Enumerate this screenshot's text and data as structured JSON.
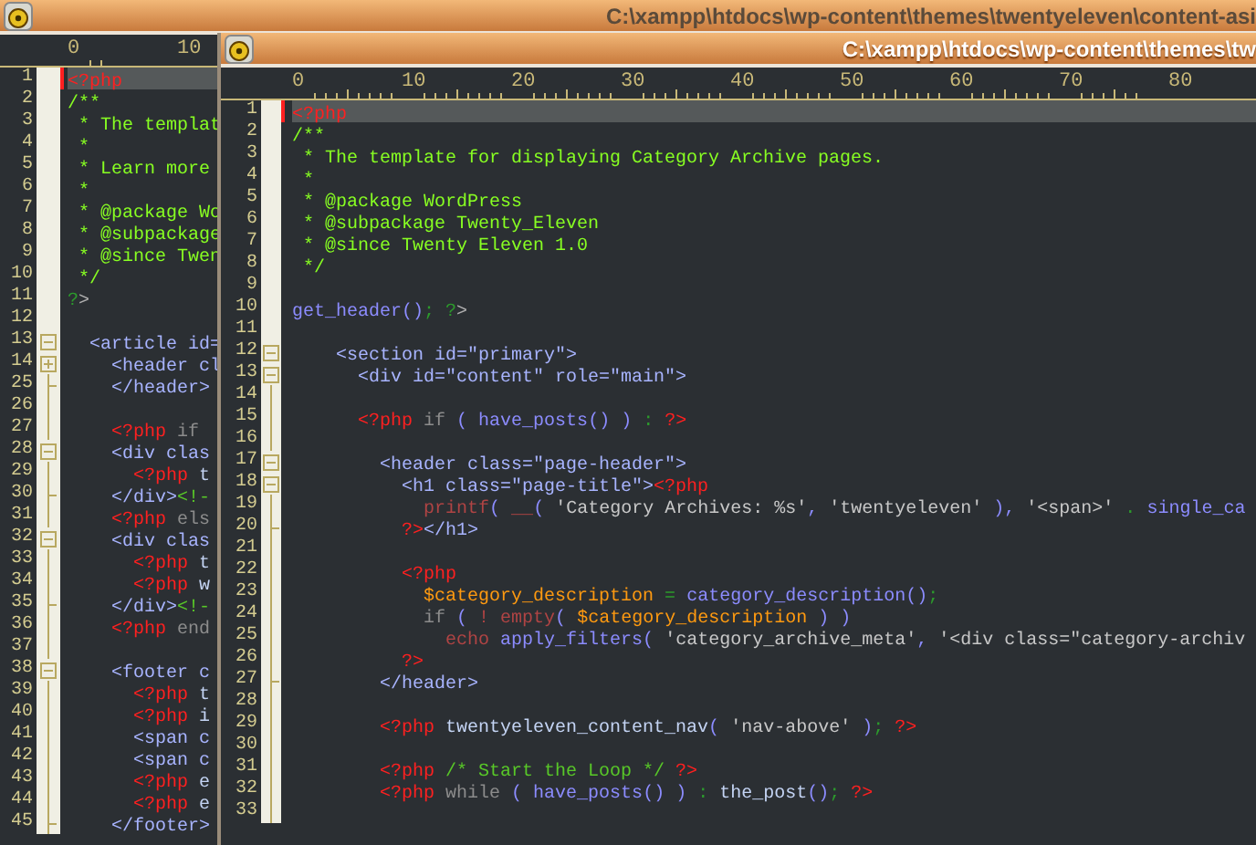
{
  "windows": [
    {
      "title": "C:\\xampp\\htdocs\\wp-content\\themes\\twentyeleven\\content-asi",
      "active": false,
      "ruler": [
        "0",
        "10"
      ],
      "lines": [
        {
          "number": "1",
          "current": true,
          "kind": "plain",
          "tokens": [
            {
              "kind": "php",
              "text": "<?php"
            }
          ]
        },
        {
          "number": "2",
          "current": false,
          "kind": "plain",
          "tokens": [
            {
              "kind": "doc",
              "text": "/**"
            }
          ]
        },
        {
          "number": "3",
          "current": false,
          "kind": "plain",
          "tokens": [
            {
              "kind": "doc",
              "text": " * The templat"
            }
          ]
        },
        {
          "number": "4",
          "current": false,
          "kind": "plain",
          "tokens": [
            {
              "kind": "doc",
              "text": " *"
            }
          ]
        },
        {
          "number": "5",
          "current": false,
          "kind": "plain",
          "tokens": [
            {
              "kind": "doc",
              "text": " * Learn more"
            }
          ]
        },
        {
          "number": "6",
          "current": false,
          "kind": "plain",
          "tokens": [
            {
              "kind": "doc",
              "text": " *"
            }
          ]
        },
        {
          "number": "7",
          "current": false,
          "kind": "plain",
          "tokens": [
            {
              "kind": "doc",
              "text": " * @package Wo"
            }
          ]
        },
        {
          "number": "8",
          "current": false,
          "kind": "plain",
          "tokens": [
            {
              "kind": "doc",
              "text": " * @subpackage"
            }
          ]
        },
        {
          "number": "9",
          "current": false,
          "kind": "plain",
          "tokens": [
            {
              "kind": "doc",
              "text": " * @since Twen"
            }
          ]
        },
        {
          "number": "10",
          "current": false,
          "kind": "plain",
          "tokens": [
            {
              "kind": "doc",
              "text": " */"
            }
          ]
        },
        {
          "number": "11",
          "current": false,
          "kind": "plain",
          "tokens": [
            {
              "kind": "semi",
              "text": "?"
            },
            {
              "kind": "plain",
              "text": ">"
            }
          ]
        },
        {
          "number": "12",
          "current": false,
          "kind": "plain"
        },
        {
          "number": "13",
          "current": false,
          "kind": "collapsible",
          "tokens": [
            {
              "kind": "tag",
              "text": "  <article id="
            }
          ]
        },
        {
          "number": "14",
          "current": false,
          "kind": "collapsed",
          "tokens": [
            {
              "kind": "tag",
              "text": "    <header cl"
            }
          ]
        },
        {
          "number": "25",
          "current": false,
          "kind": "block_end",
          "tokens": [
            {
              "kind": "tag",
              "text": "    </header>"
            }
          ]
        },
        {
          "number": "26",
          "current": false,
          "kind": "inside"
        },
        {
          "number": "27",
          "current": false,
          "kind": "inside",
          "tokens": [
            {
              "kind": "php",
              "text": "    <?php"
            },
            {
              "kind": "keyword",
              "text": " if"
            }
          ]
        },
        {
          "number": "28",
          "current": false,
          "kind": "collapsible",
          "tokens": [
            {
              "kind": "tag",
              "text": "    <div clas"
            }
          ]
        },
        {
          "number": "29",
          "current": false,
          "kind": "inside",
          "tokens": [
            {
              "kind": "php",
              "text": "      <?php"
            },
            {
              "kind": "ident",
              "text": " t"
            }
          ]
        },
        {
          "number": "30",
          "current": false,
          "kind": "block_end",
          "tokens": [
            {
              "kind": "tag",
              "text": "    </div>"
            },
            {
              "kind": "comment",
              "text": "<!-"
            }
          ]
        },
        {
          "number": "31",
          "current": false,
          "kind": "inside",
          "tokens": [
            {
              "kind": "php",
              "text": "    <?php"
            },
            {
              "kind": "keyword",
              "text": " els"
            }
          ]
        },
        {
          "number": "32",
          "current": false,
          "kind": "collapsible",
          "tokens": [
            {
              "kind": "tag",
              "text": "    <div clas"
            }
          ]
        },
        {
          "number": "33",
          "current": false,
          "kind": "inside",
          "tokens": [
            {
              "kind": "php",
              "text": "      <?php"
            },
            {
              "kind": "ident",
              "text": " t"
            }
          ]
        },
        {
          "number": "34",
          "current": false,
          "kind": "inside",
          "tokens": [
            {
              "kind": "php",
              "text": "      <?php"
            },
            {
              "kind": "ident",
              "text": " w"
            }
          ]
        },
        {
          "number": "35",
          "current": false,
          "kind": "block_end",
          "tokens": [
            {
              "kind": "tag",
              "text": "    </div>"
            },
            {
              "kind": "comment",
              "text": "<!-"
            }
          ]
        },
        {
          "number": "36",
          "current": false,
          "kind": "inside",
          "tokens": [
            {
              "kind": "php",
              "text": "    <?php"
            },
            {
              "kind": "keyword",
              "text": " end"
            }
          ]
        },
        {
          "number": "37",
          "current": false,
          "kind": "inside"
        },
        {
          "number": "38",
          "current": false,
          "kind": "collapsible",
          "tokens": [
            {
              "kind": "tag",
              "text": "    <footer c"
            }
          ]
        },
        {
          "number": "39",
          "current": false,
          "kind": "inside",
          "tokens": [
            {
              "kind": "php",
              "text": "      <?php"
            },
            {
              "kind": "ident",
              "text": " t"
            }
          ]
        },
        {
          "number": "40",
          "current": false,
          "kind": "inside",
          "tokens": [
            {
              "kind": "php",
              "text": "      <?php"
            },
            {
              "kind": "ident",
              "text": " i"
            }
          ]
        },
        {
          "number": "41",
          "current": false,
          "kind": "inside",
          "tokens": [
            {
              "kind": "tag",
              "text": "      <span c"
            }
          ]
        },
        {
          "number": "42",
          "current": false,
          "kind": "inside",
          "tokens": [
            {
              "kind": "tag",
              "text": "      <span c"
            }
          ]
        },
        {
          "number": "43",
          "current": false,
          "kind": "inside",
          "tokens": [
            {
              "kind": "php",
              "text": "      <?php"
            },
            {
              "kind": "ident",
              "text": " e"
            }
          ]
        },
        {
          "number": "44",
          "current": false,
          "kind": "inside",
          "tokens": [
            {
              "kind": "php",
              "text": "      <?php"
            },
            {
              "kind": "ident",
              "text": " e"
            }
          ]
        },
        {
          "number": "45",
          "current": false,
          "kind": "block_end",
          "tokens": [
            {
              "kind": "tag",
              "text": "    </footer>"
            }
          ]
        }
      ]
    },
    {
      "title": "C:\\xampp\\htdocs\\wp-content\\themes\\tw",
      "active": true,
      "ruler": [
        "0",
        "10",
        "20",
        "30",
        "40",
        "50",
        "60",
        "70",
        "80"
      ],
      "lines": [
        {
          "number": "1",
          "current": true,
          "kind": "plain",
          "tokens": [
            {
              "kind": "php",
              "text": "<?php"
            }
          ]
        },
        {
          "number": "2",
          "current": false,
          "kind": "plain",
          "tokens": [
            {
              "kind": "doc",
              "text": "/**"
            }
          ]
        },
        {
          "number": "3",
          "current": false,
          "kind": "plain",
          "tokens": [
            {
              "kind": "doc",
              "text": " * The template for displaying Category Archive pages."
            }
          ]
        },
        {
          "number": "4",
          "current": false,
          "kind": "plain",
          "tokens": [
            {
              "kind": "doc",
              "text": " *"
            }
          ]
        },
        {
          "number": "5",
          "current": false,
          "kind": "plain",
          "tokens": [
            {
              "kind": "doc",
              "text": " * @package WordPress"
            }
          ]
        },
        {
          "number": "6",
          "current": false,
          "kind": "plain",
          "tokens": [
            {
              "kind": "doc",
              "text": " * @subpackage Twenty_Eleven"
            }
          ]
        },
        {
          "number": "7",
          "current": false,
          "kind": "plain",
          "tokens": [
            {
              "kind": "doc",
              "text": " * @since Twenty Eleven 1.0"
            }
          ]
        },
        {
          "number": "8",
          "current": false,
          "kind": "plain",
          "tokens": [
            {
              "kind": "doc",
              "text": " */"
            }
          ]
        },
        {
          "number": "9",
          "current": false,
          "kind": "plain"
        },
        {
          "number": "10",
          "current": false,
          "kind": "plain",
          "tokens": [
            {
              "kind": "func",
              "text": "get_header"
            },
            {
              "kind": "punct",
              "text": "()"
            },
            {
              "kind": "semi",
              "text": "; ?"
            },
            {
              "kind": "plain",
              "text": ">"
            }
          ]
        },
        {
          "number": "11",
          "current": false,
          "kind": "plain"
        },
        {
          "number": "12",
          "current": false,
          "kind": "collapsible",
          "tokens": [
            {
              "kind": "tag",
              "text": "    <section id=\"primary\">"
            }
          ]
        },
        {
          "number": "13",
          "current": false,
          "kind": "collapsible",
          "tokens": [
            {
              "kind": "tag",
              "text": "      <div id=\"content\" role=\"main\">"
            }
          ]
        },
        {
          "number": "14",
          "current": false,
          "kind": "inside"
        },
        {
          "number": "15",
          "current": false,
          "kind": "inside",
          "tokens": [
            {
              "kind": "php",
              "text": "      <?php"
            },
            {
              "kind": "keyword",
              "text": " if "
            },
            {
              "kind": "punct",
              "text": "( "
            },
            {
              "kind": "func",
              "text": "have_posts"
            },
            {
              "kind": "punct",
              "text": "() ) "
            },
            {
              "kind": "semi",
              "text": ": "
            },
            {
              "kind": "php",
              "text": "?>"
            }
          ]
        },
        {
          "number": "16",
          "current": false,
          "kind": "inside"
        },
        {
          "number": "17",
          "current": false,
          "kind": "collapsible",
          "tokens": [
            {
              "kind": "tag",
              "text": "        <header class=\"page-header\">"
            }
          ]
        },
        {
          "number": "18",
          "current": false,
          "kind": "collapsible",
          "tokens": [
            {
              "kind": "tag",
              "text": "          <h1 class=\"page-title\">"
            },
            {
              "kind": "php",
              "text": "<?php"
            }
          ]
        },
        {
          "number": "19",
          "current": false,
          "kind": "inside",
          "tokens": [
            {
              "kind": "builtin",
              "text": "            printf"
            },
            {
              "kind": "punct",
              "text": "( "
            },
            {
              "kind": "builtin",
              "text": "__"
            },
            {
              "kind": "punct",
              "text": "( "
            },
            {
              "kind": "string",
              "text": "'Category Archives: %s'"
            },
            {
              "kind": "punct",
              "text": ", "
            },
            {
              "kind": "string",
              "text": "'twentyeleven'"
            },
            {
              "kind": "punct",
              "text": " ), "
            },
            {
              "kind": "string",
              "text": "'<span>'"
            },
            {
              "kind": "semi",
              "text": " . "
            },
            {
              "kind": "func",
              "text": "single_ca"
            }
          ]
        },
        {
          "number": "20",
          "current": false,
          "kind": "block_end",
          "tokens": [
            {
              "kind": "php",
              "text": "          ?>"
            },
            {
              "kind": "tag",
              "text": "</h1>"
            }
          ]
        },
        {
          "number": "21",
          "current": false,
          "kind": "inside"
        },
        {
          "number": "22",
          "current": false,
          "kind": "inside",
          "tokens": [
            {
              "kind": "php",
              "text": "          <?php"
            }
          ]
        },
        {
          "number": "23",
          "current": false,
          "kind": "inside",
          "tokens": [
            {
              "kind": "var",
              "text": "            $category_description"
            },
            {
              "kind": "semi",
              "text": " = "
            },
            {
              "kind": "func",
              "text": "category_description"
            },
            {
              "kind": "punct",
              "text": "()"
            },
            {
              "kind": "semi",
              "text": ";"
            }
          ]
        },
        {
          "number": "24",
          "current": false,
          "kind": "inside",
          "tokens": [
            {
              "kind": "keyword",
              "text": "            if "
            },
            {
              "kind": "punct",
              "text": "( "
            },
            {
              "kind": "builtin",
              "text": "! empty"
            },
            {
              "kind": "punct",
              "text": "( "
            },
            {
              "kind": "var",
              "text": "$category_description"
            },
            {
              "kind": "punct",
              "text": " ) )"
            }
          ]
        },
        {
          "number": "25",
          "current": false,
          "kind": "inside",
          "tokens": [
            {
              "kind": "builtin",
              "text": "              echo "
            },
            {
              "kind": "func",
              "text": "apply_filters"
            },
            {
              "kind": "punct",
              "text": "( "
            },
            {
              "kind": "string",
              "text": "'category_archive_meta'"
            },
            {
              "kind": "punct",
              "text": ", "
            },
            {
              "kind": "string",
              "text": "'<div class=\"category-archiv"
            }
          ]
        },
        {
          "number": "26",
          "current": false,
          "kind": "inside",
          "tokens": [
            {
              "kind": "php",
              "text": "          ?>"
            }
          ]
        },
        {
          "number": "27",
          "current": false,
          "kind": "block_end",
          "tokens": [
            {
              "kind": "tag",
              "text": "        </header>"
            }
          ]
        },
        {
          "number": "28",
          "current": false,
          "kind": "inside"
        },
        {
          "number": "29",
          "current": false,
          "kind": "inside",
          "tokens": [
            {
              "kind": "php",
              "text": "        <?php"
            },
            {
              "kind": "ident",
              "text": " twentyeleven_content_nav"
            },
            {
              "kind": "punct",
              "text": "( "
            },
            {
              "kind": "string",
              "text": "'nav-above'"
            },
            {
              "kind": "punct",
              "text": " )"
            },
            {
              "kind": "semi",
              "text": "; "
            },
            {
              "kind": "php",
              "text": "?>"
            }
          ]
        },
        {
          "number": "30",
          "current": false,
          "kind": "inside"
        },
        {
          "number": "31",
          "current": false,
          "kind": "inside",
          "tokens": [
            {
              "kind": "php",
              "text": "        <?php"
            },
            {
              "kind": "comment",
              "text": " /* Start the Loop */ "
            },
            {
              "kind": "php",
              "text": "?>"
            }
          ]
        },
        {
          "number": "32",
          "current": false,
          "kind": "inside",
          "tokens": [
            {
              "kind": "php",
              "text": "        <?php"
            },
            {
              "kind": "keyword",
              "text": " while "
            },
            {
              "kind": "punct",
              "text": "( "
            },
            {
              "kind": "func",
              "text": "have_posts"
            },
            {
              "kind": "punct",
              "text": "() ) "
            },
            {
              "kind": "semi",
              "text": ": "
            },
            {
              "kind": "ident",
              "text": "the_post"
            },
            {
              "kind": "punct",
              "text": "()"
            },
            {
              "kind": "semi",
              "text": "; "
            },
            {
              "kind": "php",
              "text": "?>"
            }
          ]
        },
        {
          "number": "33",
          "current": false,
          "kind": "inside"
        }
      ]
    }
  ]
}
